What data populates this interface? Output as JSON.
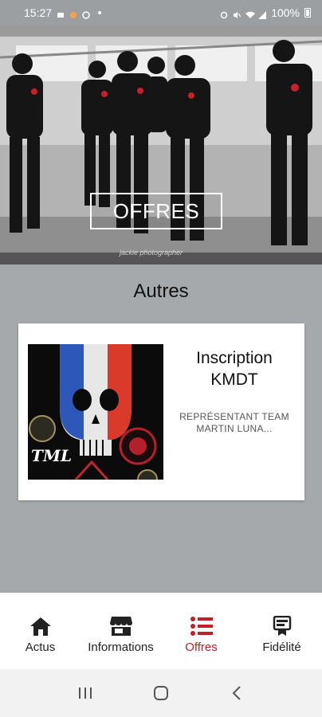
{
  "status_bar": {
    "time": "15:27",
    "battery": "100%"
  },
  "hero": {
    "button_label": "OFFRES",
    "watermark": "jackie photographer"
  },
  "section": {
    "title": "Autres"
  },
  "card": {
    "title": "Inscription KMDT",
    "description": "REPRÉSENTANT TEAM MARTIN LUNA...",
    "image_text": "TML"
  },
  "bottom_nav": {
    "items": [
      {
        "label": "Actus",
        "icon": "home-icon"
      },
      {
        "label": "Informations",
        "icon": "store-icon"
      },
      {
        "label": "Offres",
        "icon": "list-icon"
      },
      {
        "label": "Fidélité",
        "icon": "loyalty-icon"
      }
    ],
    "active_index": 2
  },
  "colors": {
    "accent": "#c21f27",
    "background": "#a6a9ab"
  }
}
